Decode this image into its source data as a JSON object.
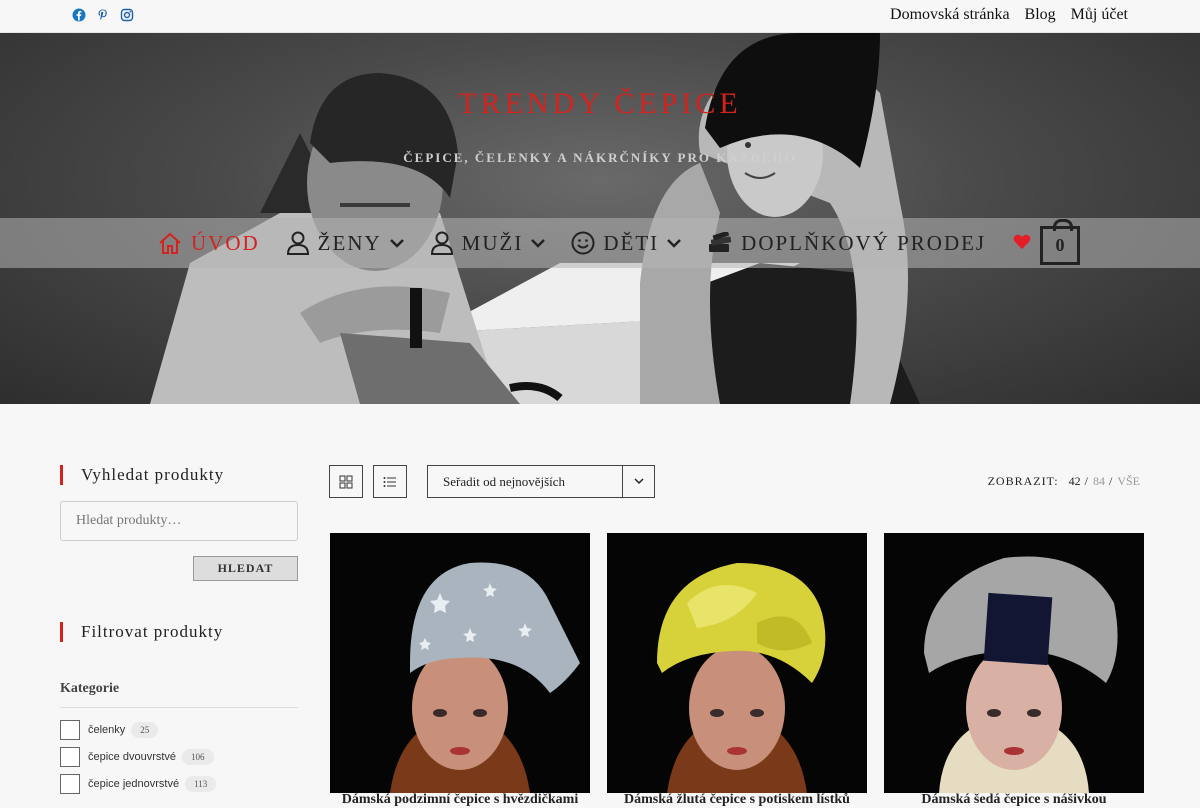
{
  "topbar": {
    "social": [
      "facebook-icon",
      "pinterest-icon",
      "instagram-icon"
    ],
    "links": [
      "Domovská stránka",
      "Blog",
      "Můj účet"
    ]
  },
  "site": {
    "title": "TRENDY ČEPICE",
    "description": "ČEPICE, ČELENKY A NÁKRČNÍKY PRO KAŽDÉHO"
  },
  "menu": {
    "items": [
      {
        "label": "ÚVOD",
        "icon": "home-icon",
        "active": true
      },
      {
        "label": "ŽENY",
        "icon": "user-icon",
        "dropdown": true
      },
      {
        "label": "MUŽI",
        "icon": "user-icon",
        "dropdown": true
      },
      {
        "label": "DĚTI",
        "icon": "smile-icon",
        "dropdown": true
      },
      {
        "label": "DOPLŇKOVÝ PRODEJ",
        "icon": "money-icon"
      }
    ],
    "cart_count": "0"
  },
  "sidebar": {
    "search_title": "Vyhledat produkty",
    "search_placeholder": "Hledat produkty…",
    "search_button": "HLEDAT",
    "filter_title": "Filtrovat produkty",
    "category_heading": "Kategorie",
    "categories": [
      {
        "name": "čelenky",
        "count": "25"
      },
      {
        "name": "čepice dvouvrstvé",
        "count": "106"
      },
      {
        "name": "čepice jednovrstvé",
        "count": "113"
      }
    ]
  },
  "toolbar": {
    "sort_label": "Seřadit od nejnovějších",
    "show_label": "ZOBRAZIT:",
    "show_options": [
      "42",
      "84",
      "VŠE"
    ],
    "separator": "/"
  },
  "products": [
    {
      "title": "Dámská podzimní čepice s hvězdičkami",
      "hat_color": "#a9b4bf"
    },
    {
      "title": "Dámská žlutá čepice s potiskem lístků",
      "hat_color": "#d8d23a"
    },
    {
      "title": "Dámská šedá čepice s nášivkou",
      "hat_color": "#a6a6a6"
    }
  ],
  "colors": {
    "accent": "#d4231f"
  }
}
